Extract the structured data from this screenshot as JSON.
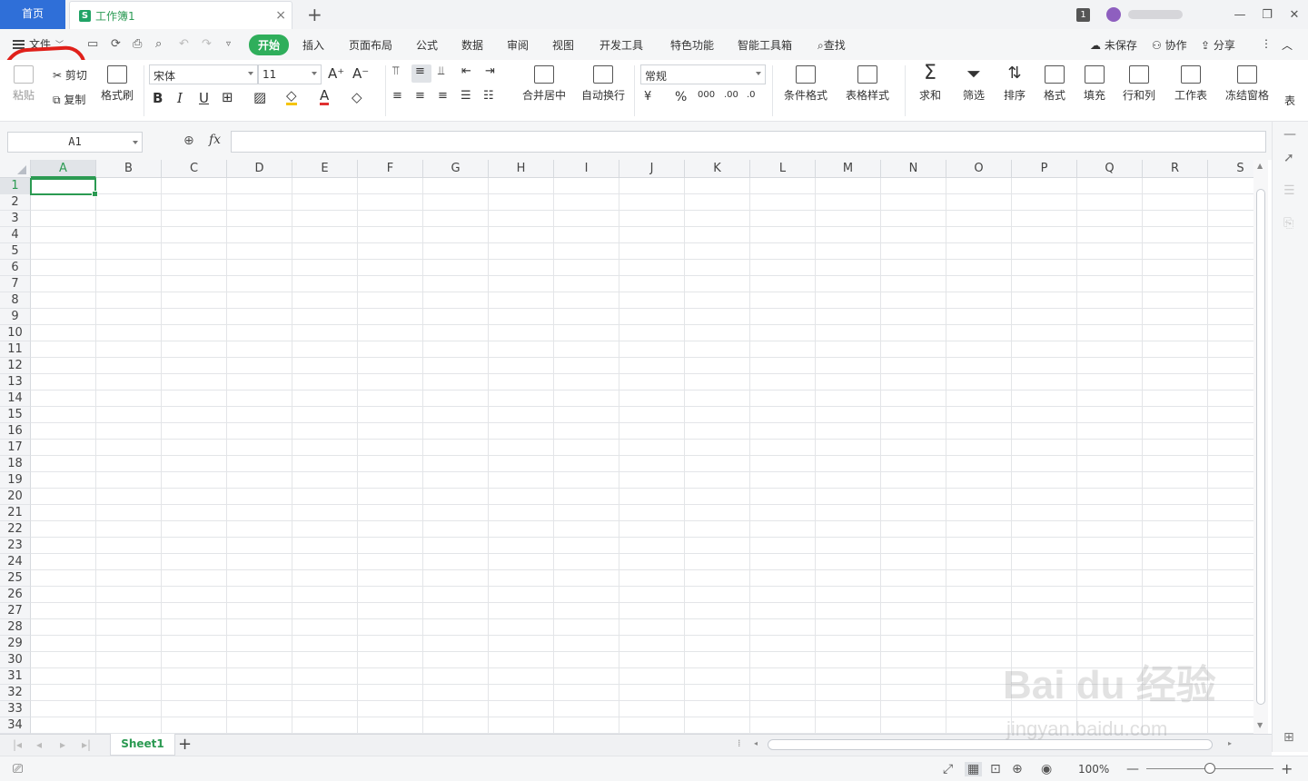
{
  "titlebar": {
    "home_tab": "首页",
    "doc_tab": "工作簿1",
    "doc_icon_letter": "S",
    "window_count": "1",
    "close": "×",
    "new_tab": "+",
    "min": "—",
    "restore": "❐",
    "win_close": "✕"
  },
  "menubar": {
    "file": "文件",
    "tabs": [
      "开始",
      "插入",
      "页面布局",
      "公式",
      "数据",
      "审阅",
      "视图",
      "开发工具",
      "特色功能",
      "智能工具箱"
    ],
    "search": "查找",
    "unsaved": "未保存",
    "collab": "协作",
    "share": "分享"
  },
  "ribbon": {
    "paste": "粘贴",
    "cut": "剪切",
    "copy": "复制",
    "format_painter": "格式刷",
    "font_name": "宋体",
    "font_size": "11",
    "merge_center": "合并居中",
    "wrap_text": "自动换行",
    "number_format": "常规",
    "conditional_format": "条件格式",
    "table_style": "表格样式",
    "sum": "求和",
    "filter": "筛选",
    "sort": "排序",
    "format": "格式",
    "fill": "填充",
    "row_col": "行和列",
    "worksheet": "工作表",
    "freeze": "冻结窗格",
    "more": "表"
  },
  "formula": {
    "name_box": "A1",
    "fx": "fx"
  },
  "grid": {
    "columns": [
      "A",
      "B",
      "C",
      "D",
      "E",
      "F",
      "G",
      "H",
      "I",
      "J",
      "K",
      "L",
      "M",
      "N",
      "O",
      "P",
      "Q",
      "R",
      "S"
    ],
    "rows": [
      "1",
      "2",
      "3",
      "4",
      "5",
      "6",
      "7",
      "8",
      "9",
      "10",
      "11",
      "12",
      "13",
      "14",
      "15",
      "16",
      "17",
      "18",
      "19",
      "20",
      "21",
      "22",
      "23",
      "24",
      "25",
      "26",
      "27",
      "28",
      "29",
      "30",
      "31",
      "32",
      "33",
      "34"
    ],
    "selected_col": "A",
    "selected_row": "1"
  },
  "sheets": {
    "active": "Sheet1",
    "add": "+"
  },
  "status": {
    "zoom": "100%"
  },
  "watermark": {
    "brand": "Bai du 经验",
    "url": "jingyan.baidu.com"
  },
  "colors": {
    "accent_green": "#2fae5b",
    "home_blue": "#2f6fd8",
    "annotation_red": "#e0201a"
  }
}
